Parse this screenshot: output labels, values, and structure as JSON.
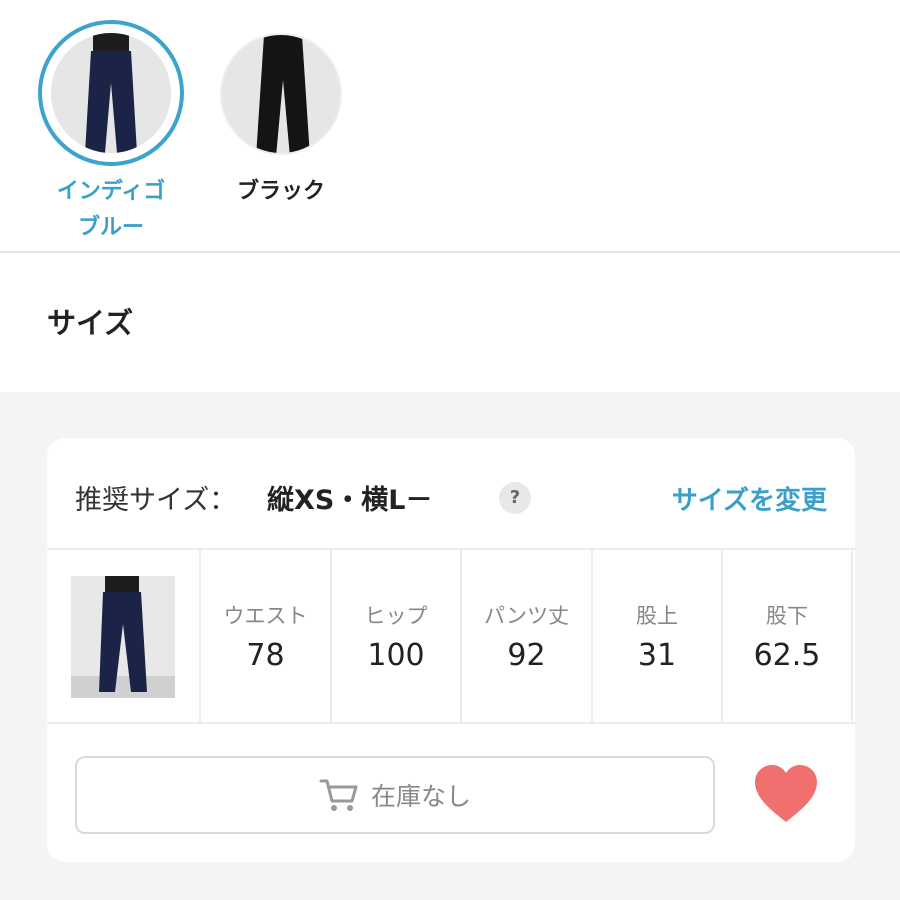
{
  "colors": {
    "accent": "#3a9fc9",
    "heart": "#f07070",
    "indigo_pants": "#1b2446",
    "black_pants": "#141414"
  },
  "swatches": [
    {
      "label_line1": "インディゴ",
      "label_line2": "ブルー",
      "selected": true
    },
    {
      "label_line1": "ブラック",
      "selected": false
    }
  ],
  "size_section": {
    "heading": "サイズ"
  },
  "recommendation": {
    "prefix": "推奨サイズ：",
    "value": "縦XS・横L－",
    "help_icon": "question-icon",
    "change_link": "サイズを変更"
  },
  "size_table": {
    "columns": [
      {
        "label": "ウエスト",
        "value": "78"
      },
      {
        "label": "ヒップ",
        "value": "100"
      },
      {
        "label": "パンツ丈",
        "value": "92"
      },
      {
        "label": "股上",
        "value": "31"
      },
      {
        "label": "股下",
        "value": "62.5"
      }
    ]
  },
  "actions": {
    "stock_button_label": "在庫なし",
    "stock_button_icon": "cart-icon",
    "favorite_icon": "heart-icon"
  }
}
